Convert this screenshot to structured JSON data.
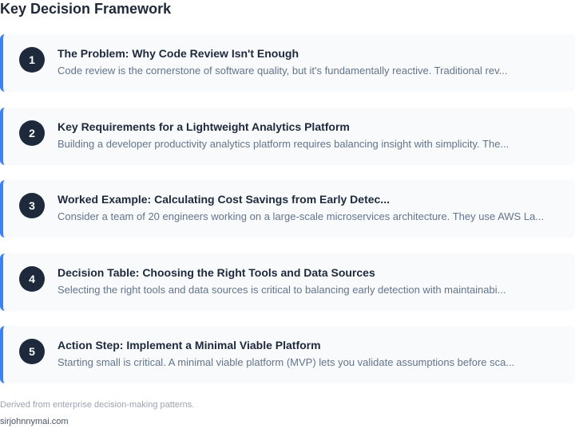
{
  "page": {
    "title": "Key Decision Framework"
  },
  "colors": {
    "accent": "#3b82f6",
    "badge": "#1e293b",
    "card_bg": "#f8fafc"
  },
  "cards": [
    {
      "number": "1",
      "title": "The Problem: Why Code Review Isn't Enough",
      "description": "Code review is the cornerstone of software quality, but it's fundamentally reactive. Traditional rev..."
    },
    {
      "number": "2",
      "title": "Key Requirements for a Lightweight Analytics Platform",
      "description": "Building a developer productivity analytics platform requires balancing insight with simplicity. The..."
    },
    {
      "number": "3",
      "title": "Worked Example: Calculating Cost Savings from Early Detec...",
      "description": "Consider a team of 20 engineers working on a large-scale microservices architecture. They use AWS La..."
    },
    {
      "number": "4",
      "title": "Decision Table: Choosing the Right Tools and Data Sources",
      "description": "Selecting the right tools and data sources is critical to balancing early detection with maintainabi..."
    },
    {
      "number": "5",
      "title": "Action Step: Implement a Minimal Viable Platform",
      "description": "Starting small is critical. A minimal viable platform (MVP) lets you validate assumptions before sca..."
    }
  ],
  "footer": {
    "note": "Derived from enterprise decision-making patterns.",
    "site": "sirjohnnymai.com"
  }
}
